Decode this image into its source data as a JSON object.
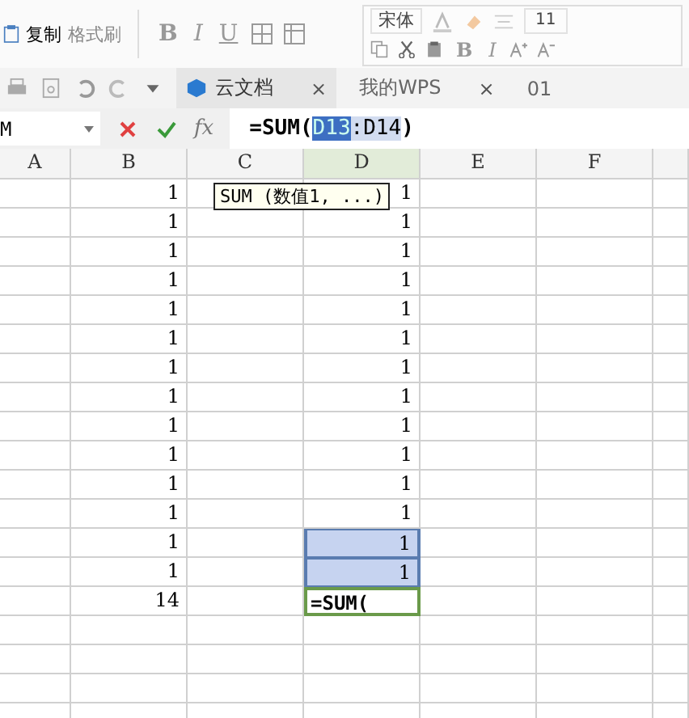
{
  "toolbar": {
    "copy": "复制",
    "format_painter": "格式刷",
    "bold": "B",
    "italic": "I",
    "underline": "U"
  },
  "mini_toolbar": {
    "font": "宋体",
    "size": "11",
    "bold": "B",
    "italic": "I"
  },
  "tabs": [
    {
      "label": "云文档",
      "close": "×",
      "selected": true
    },
    {
      "label": "我的WPS",
      "close": "×",
      "selected": false
    },
    {
      "label": "01",
      "selected": false
    }
  ],
  "name_box": "M",
  "formula_bar": {
    "fx": "fx",
    "before": "=SUM(",
    "selected_text": "D13",
    "after": ":D14)"
  },
  "tooltip": "SUM (数值1, ...)",
  "columns": [
    "A",
    "B",
    "C",
    "D",
    "E",
    "F"
  ],
  "rows": [
    {
      "b": "1",
      "d": "1",
      "d_selected": false
    },
    {
      "b": "1",
      "d": "1",
      "d_selected": false
    },
    {
      "b": "1",
      "d": "1",
      "d_selected": false
    },
    {
      "b": "1",
      "d": "1",
      "d_selected": false
    },
    {
      "b": "1",
      "d": "1",
      "d_selected": false
    },
    {
      "b": "1",
      "d": "1",
      "d_selected": false
    },
    {
      "b": "1",
      "d": "1",
      "d_selected": false
    },
    {
      "b": "1",
      "d": "1",
      "d_selected": false
    },
    {
      "b": "1",
      "d": "1",
      "d_selected": false
    },
    {
      "b": "1",
      "d": "1",
      "d_selected": false
    },
    {
      "b": "1",
      "d": "1",
      "d_selected": false
    },
    {
      "b": "1",
      "d": "1",
      "d_selected": false
    },
    {
      "b": "1",
      "d": "1",
      "d_selected": true
    },
    {
      "b": "1",
      "d": "1",
      "d_selected": true
    },
    {
      "b": "14",
      "d": "=SUM(",
      "d_selected": false,
      "d_editing": true
    }
  ]
}
